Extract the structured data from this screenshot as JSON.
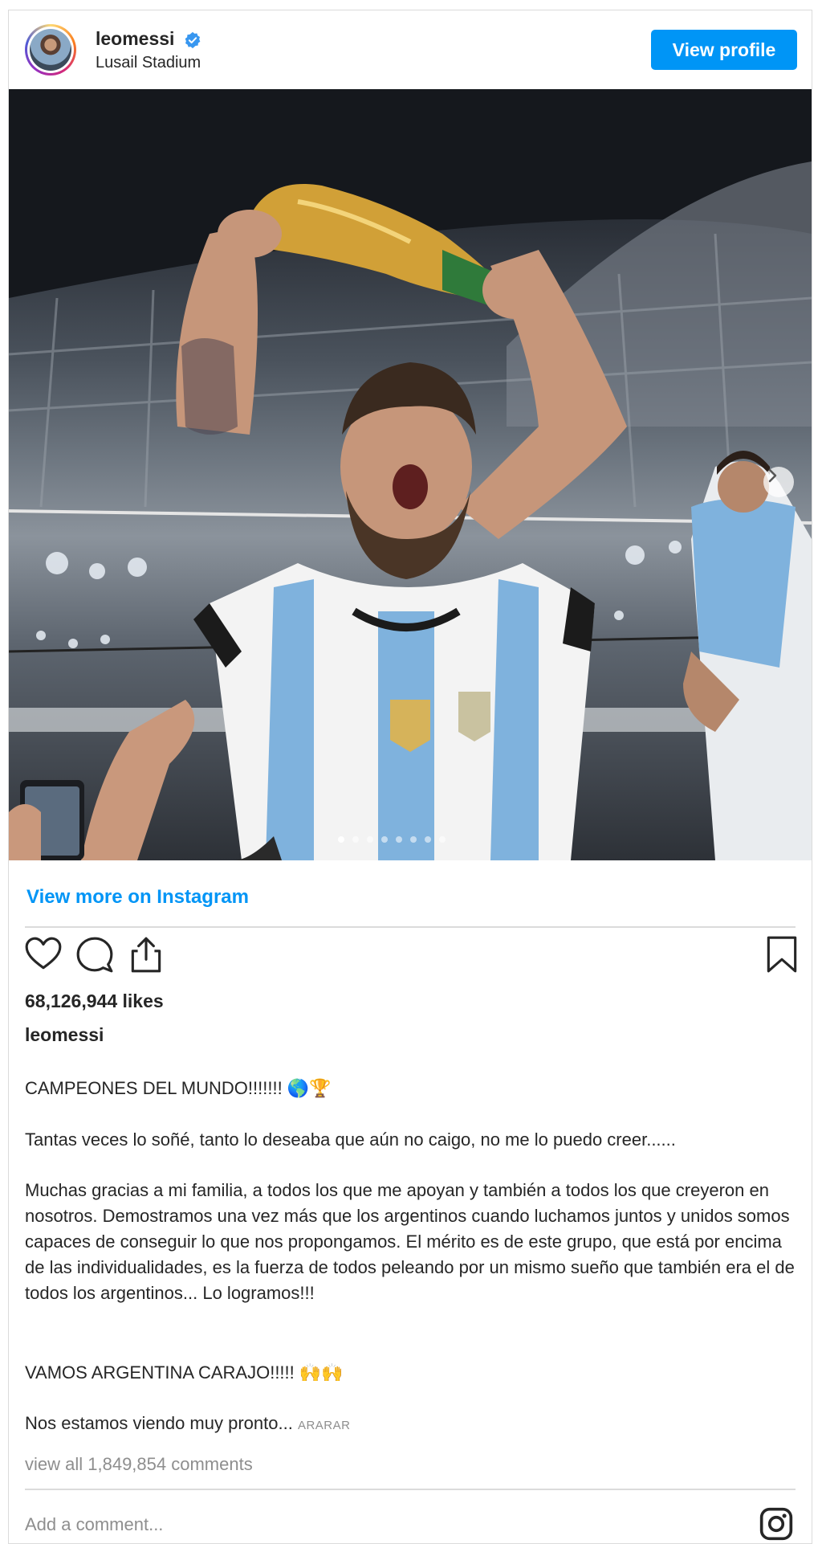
{
  "header": {
    "username": "leomessi",
    "location": "Lusail Stadium",
    "view_profile_label": "View profile"
  },
  "photo": {
    "carousel_total": 8,
    "carousel_active": 1
  },
  "view_more_label": "View more on Instagram",
  "likes": "68,126,944 likes",
  "caption": {
    "username": "leomessi",
    "line1": "CAMPEONES DEL MUNDO!!!!!!! 🌎🏆",
    "line2": "Tantas veces lo soñé, tanto lo deseaba que aún no caigo, no me lo puedo creer......",
    "line3": "Muchas gracias a mi familia, a todos los que me apoyan y también a todos los que creyeron en nosotros. Demostramos una vez más que los argentinos cuando luchamos juntos y unidos somos capaces de conseguir lo que nos propongamos. El mérito es de este grupo, que está por encima de las individualidades, es la fuerza de todos peleando por un mismo sueño que también era el de todos los argentinos... Lo logramos!!!",
    "line4": "VAMOS ARGENTINA CARAJO!!!!! 🙌🙌",
    "line5": "Nos estamos viendo muy pronto...",
    "more_label": "ARARAR"
  },
  "view_all_comments": "view all 1,849,854 comments",
  "add_comment_placeholder": "Add a comment...",
  "colors": {
    "accent": "#0095f6",
    "text": "#262626",
    "muted": "#8e8e8e",
    "border": "#dbdbdb"
  }
}
